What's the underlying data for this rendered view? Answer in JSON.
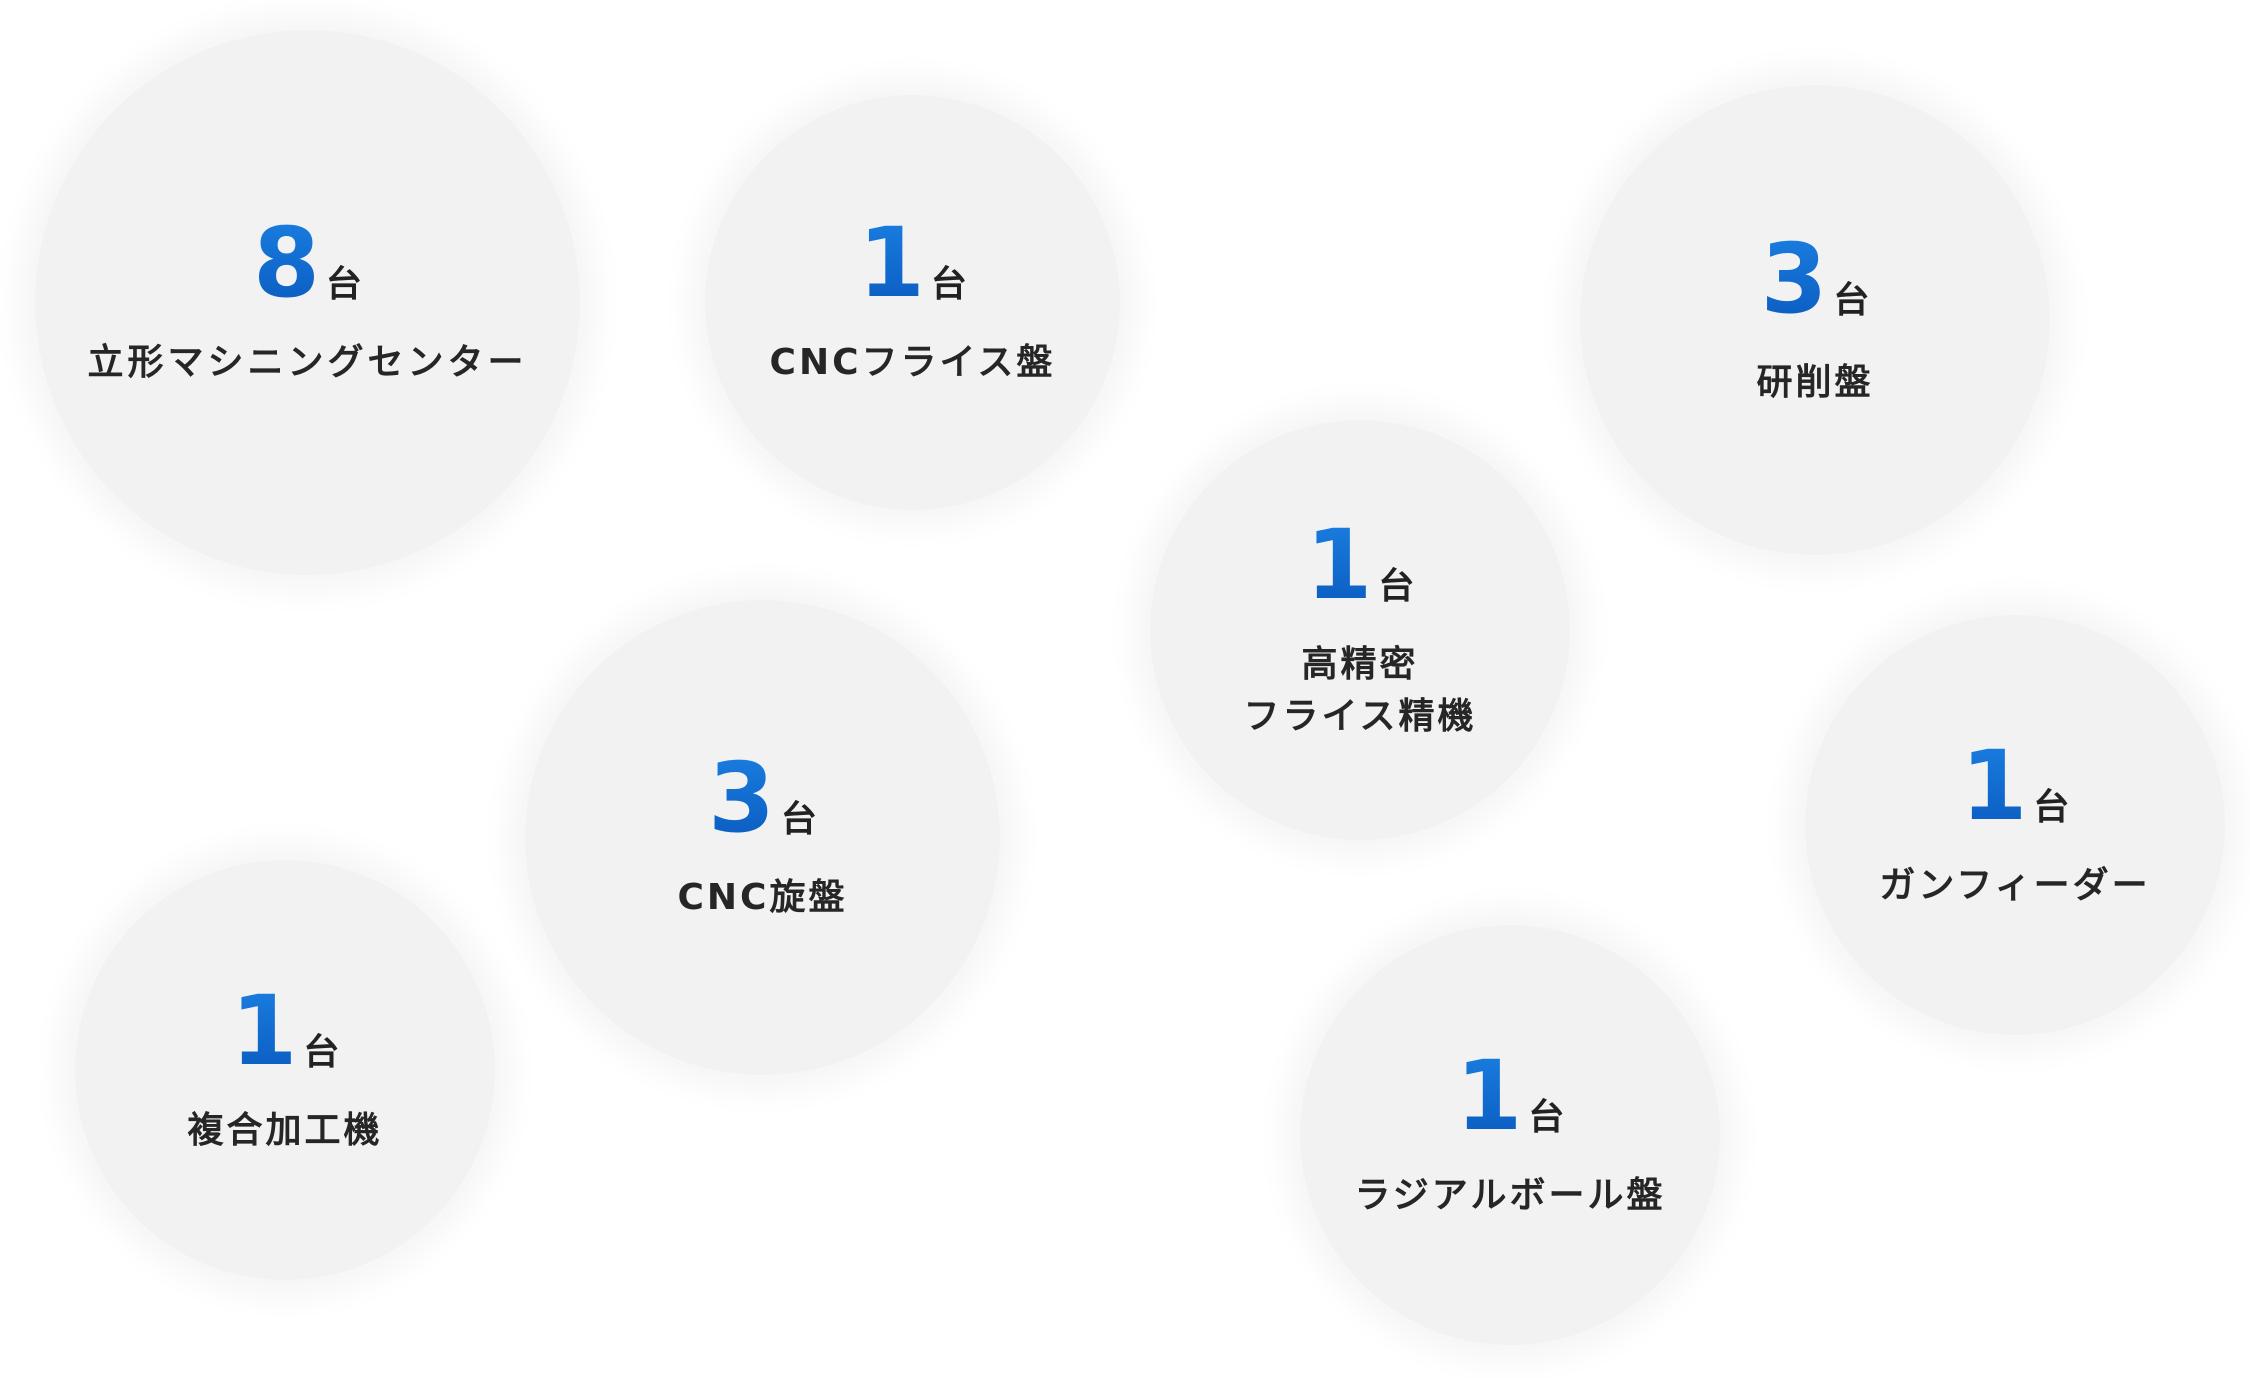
{
  "unit": "台",
  "machines": [
    {
      "id": "vmc",
      "count": "8",
      "label": "立形マシニングセンター"
    },
    {
      "id": "cnc-milling",
      "count": "1",
      "label": "CNCフライス盤"
    },
    {
      "id": "grinding",
      "count": "3",
      "label": "研削盤"
    },
    {
      "id": "precision-milling",
      "count": "1",
      "label_line1": "高精密",
      "label_line2": "フライス精機"
    },
    {
      "id": "cnc-lathe",
      "count": "3",
      "label": "CNC旋盤"
    },
    {
      "id": "gun-feeder",
      "count": "1",
      "label": "ガンフィーダー"
    },
    {
      "id": "multi-tasking",
      "count": "1",
      "label": "複合加工機"
    },
    {
      "id": "radial-ball",
      "count": "1",
      "label": "ラジアルボール盤"
    }
  ],
  "colors": {
    "accent": "#0a63c9",
    "bubble": "#f2f2f2",
    "text": "#262626"
  }
}
